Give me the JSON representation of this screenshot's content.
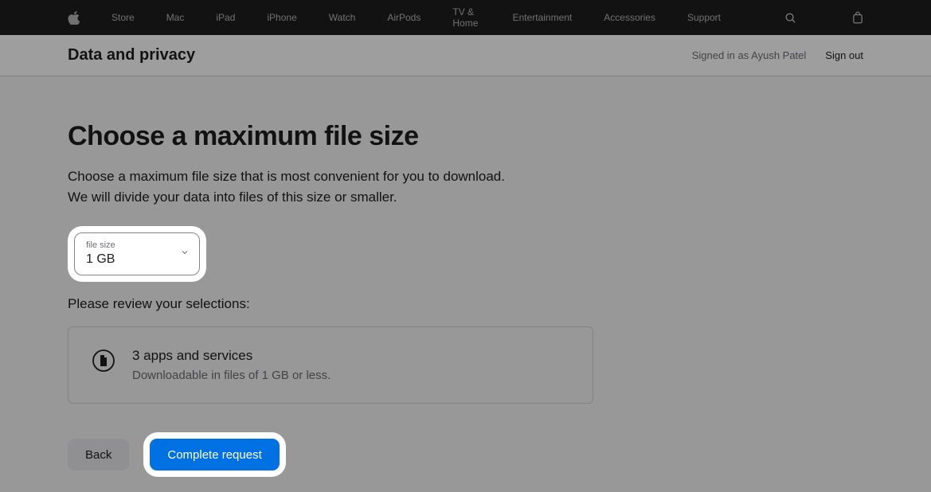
{
  "nav": {
    "items": [
      "Store",
      "Mac",
      "iPad",
      "iPhone",
      "Watch",
      "AirPods",
      "TV & Home",
      "Entertainment",
      "Accessories",
      "Support"
    ]
  },
  "sub_header": {
    "title": "Data and privacy",
    "signed_in": "Signed in as Ayush Patel",
    "sign_out": "Sign out"
  },
  "main": {
    "title": "Choose a maximum file size",
    "desc_line1": "Choose a maximum file size that is most convenient for you to download.",
    "desc_line2": "We will divide your data into files of this size or smaller.",
    "select": {
      "label": "file size",
      "value": "1 GB"
    },
    "review_label": "Please review your selections:",
    "review": {
      "title": "3 apps and services",
      "subtitle": "Downloadable in files of 1 GB or less."
    },
    "buttons": {
      "back": "Back",
      "complete": "Complete request"
    }
  }
}
